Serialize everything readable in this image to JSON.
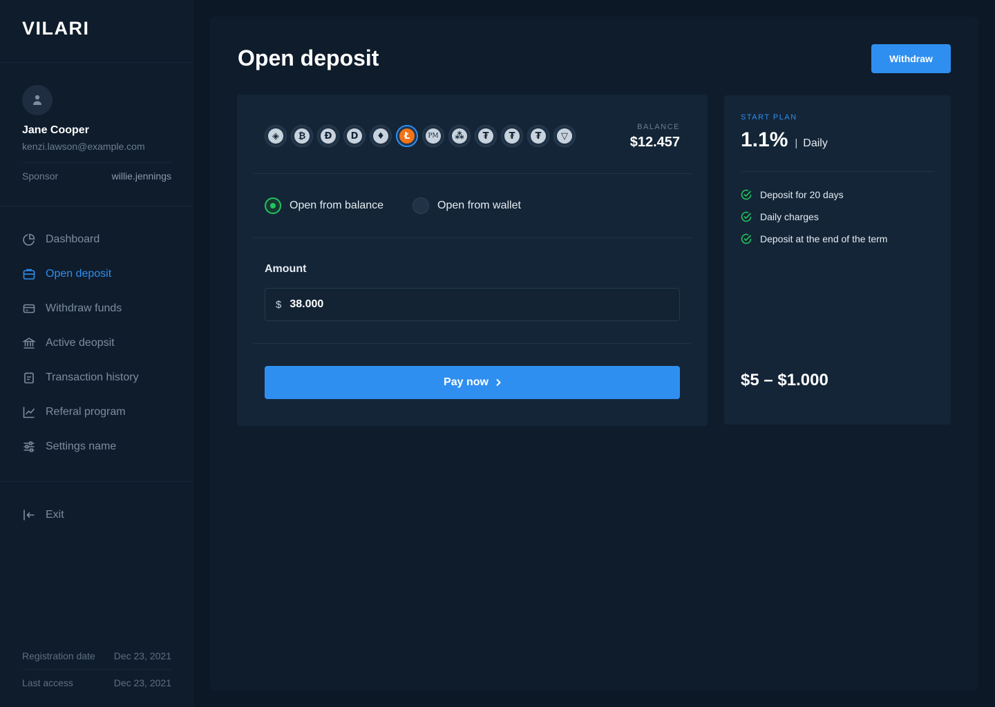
{
  "app": {
    "logo": "VILARI"
  },
  "user": {
    "name": "Jane Cooper",
    "email": "kenzi.lawson@example.com",
    "sponsor_label": "Sponsor",
    "sponsor_value": "willie.jennings"
  },
  "nav": {
    "items": [
      {
        "label": "Dashboard",
        "icon": "pie-chart-icon"
      },
      {
        "label": "Open deposit",
        "icon": "briefcase-icon",
        "active": true
      },
      {
        "label": "Withdraw funds",
        "icon": "credit-card-icon"
      },
      {
        "label": "Active deopsit",
        "icon": "bank-icon"
      },
      {
        "label": "Transaction history",
        "icon": "clipboard-icon"
      },
      {
        "label": "Referal program",
        "icon": "line-chart-icon"
      },
      {
        "label": "Settings name",
        "icon": "sliders-icon"
      }
    ],
    "exit": "Exit"
  },
  "meta": {
    "registration_label": "Registration date",
    "registration_value": "Dec 23, 2021",
    "access_label": "Last access",
    "access_value": "Dec 23, 2021"
  },
  "page": {
    "title": "Open deposit",
    "withdraw_button": "Withdraw"
  },
  "coins": [
    {
      "name": "binance-coin-icon",
      "glyph": "◈"
    },
    {
      "name": "bitcoin-icon",
      "glyph": "₿"
    },
    {
      "name": "dash-icon",
      "glyph": "Đ"
    },
    {
      "name": "dogecoin-icon",
      "glyph": "D"
    },
    {
      "name": "ethereum-icon",
      "glyph": "♦"
    },
    {
      "name": "litecoin-icon",
      "glyph": "Ł",
      "selected": true
    },
    {
      "name": "perfect-money-icon",
      "glyph": "PM"
    },
    {
      "name": "ripple-icon",
      "glyph": "⁂"
    },
    {
      "name": "tether-icon",
      "glyph": "₮"
    },
    {
      "name": "tether-icon",
      "glyph": "₮"
    },
    {
      "name": "tether-icon",
      "glyph": "₮"
    },
    {
      "name": "tron-icon",
      "glyph": "▽"
    }
  ],
  "balance": {
    "label": "BALANCE",
    "value": "$12.457"
  },
  "source": {
    "balance_label": "Open from balance",
    "wallet_label": "Open from wallet",
    "selected": "balance"
  },
  "amount": {
    "label": "Amount",
    "currency": "$",
    "value": "38.000"
  },
  "pay": {
    "label": "Pay now"
  },
  "plan": {
    "label": "START PLAN",
    "rate": "1.1%",
    "separator": "|",
    "period": "Daily",
    "features": [
      "Deposit for 20 days",
      "Daily charges",
      "Deposit at the end of the term"
    ],
    "range": "$5 – $1.000"
  },
  "colors": {
    "accent": "#2f8ff0",
    "success": "#22c55e",
    "litecoin": "#f1731a",
    "background": "#0d1826",
    "panel": "#0f1c2b",
    "card": "#142537"
  }
}
